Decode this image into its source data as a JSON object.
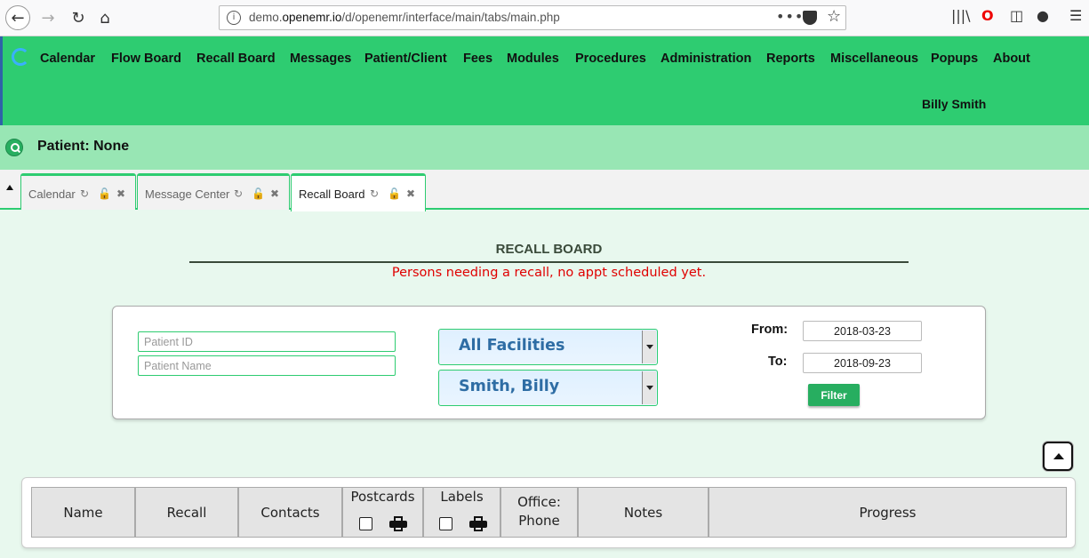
{
  "browser": {
    "url_prefix": "demo.",
    "url_domain": "openemr.io",
    "url_path": "/d/openemr/interface/main/tabs/main.php",
    "more_glyph": "•••"
  },
  "nav": {
    "menu": [
      "Calendar",
      "Flow Board",
      "Recall Board",
      "Messages",
      "Patient/Client",
      "Fees",
      "Modules",
      "Procedures",
      "Administration",
      "Reports",
      "Miscellaneous",
      "Popups",
      "About"
    ],
    "user": "Billy Smith"
  },
  "patient": {
    "label": "Patient: None"
  },
  "tabs": [
    {
      "label": "Calendar",
      "active": false
    },
    {
      "label": "Message Center",
      "active": false
    },
    {
      "label": "Recall Board",
      "active": true
    }
  ],
  "recall": {
    "title": "RECALL BOARD",
    "subtitle": "Persons needing a recall, no appt scheduled yet."
  },
  "filters": {
    "patient_id_placeholder": "Patient ID",
    "patient_name_placeholder": "Patient Name",
    "facility": "All Facilities",
    "provider": "Smith, Billy",
    "from_label": "From:",
    "to_label": "To:",
    "from_date": "2018-03-23",
    "to_date": "2018-09-23",
    "filter_label": "Filter"
  },
  "table": {
    "headers": {
      "name": "Name",
      "recall": "Recall",
      "contacts": "Contacts",
      "postcards": "Postcards",
      "labels": "Labels",
      "office_line1": "Office:",
      "office_line2": "Phone",
      "notes": "Notes",
      "progress": "Progress"
    }
  },
  "colors": {
    "nav_green": "#2ecc71",
    "patient_bar": "#98e6b4",
    "subtitle_red": "#e00000",
    "filter_button": "#27ae60",
    "select_text": "#2e6da4"
  }
}
